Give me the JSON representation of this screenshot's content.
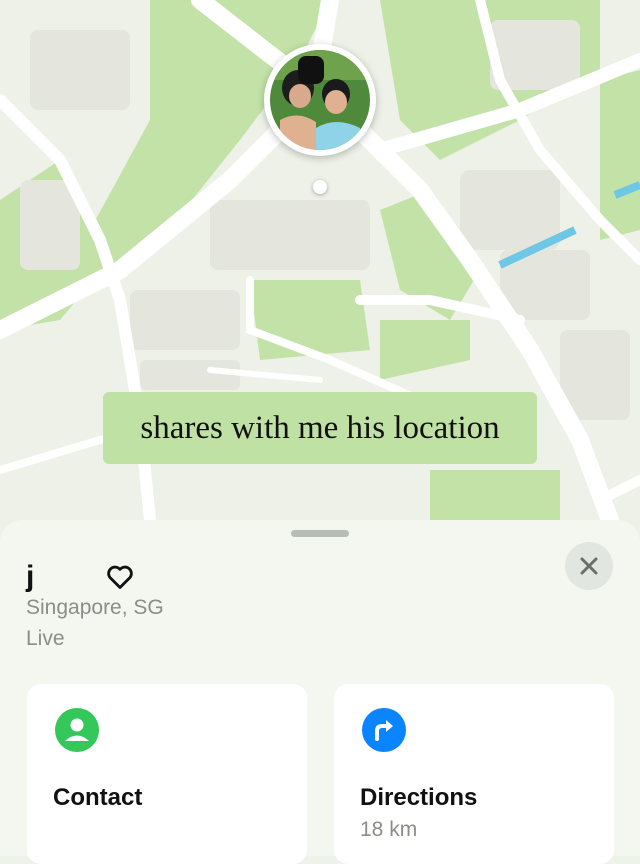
{
  "map": {
    "caption": "shares with me his location",
    "colors": {
      "land": "#eef1e7",
      "park": "#bfe0a4",
      "road": "#ffffff",
      "water": "#6fc7e6",
      "block": "#e3e5dd"
    }
  },
  "sheet": {
    "name": "j",
    "location": "Singapore, SG",
    "status": "Live"
  },
  "actions": {
    "contact": {
      "label": "Contact",
      "icon": "person-icon",
      "color": "#34c759"
    },
    "directions": {
      "label": "Directions",
      "distance": "18 km",
      "icon": "turn-right-arrow-icon",
      "color": "#0a84ff"
    }
  }
}
